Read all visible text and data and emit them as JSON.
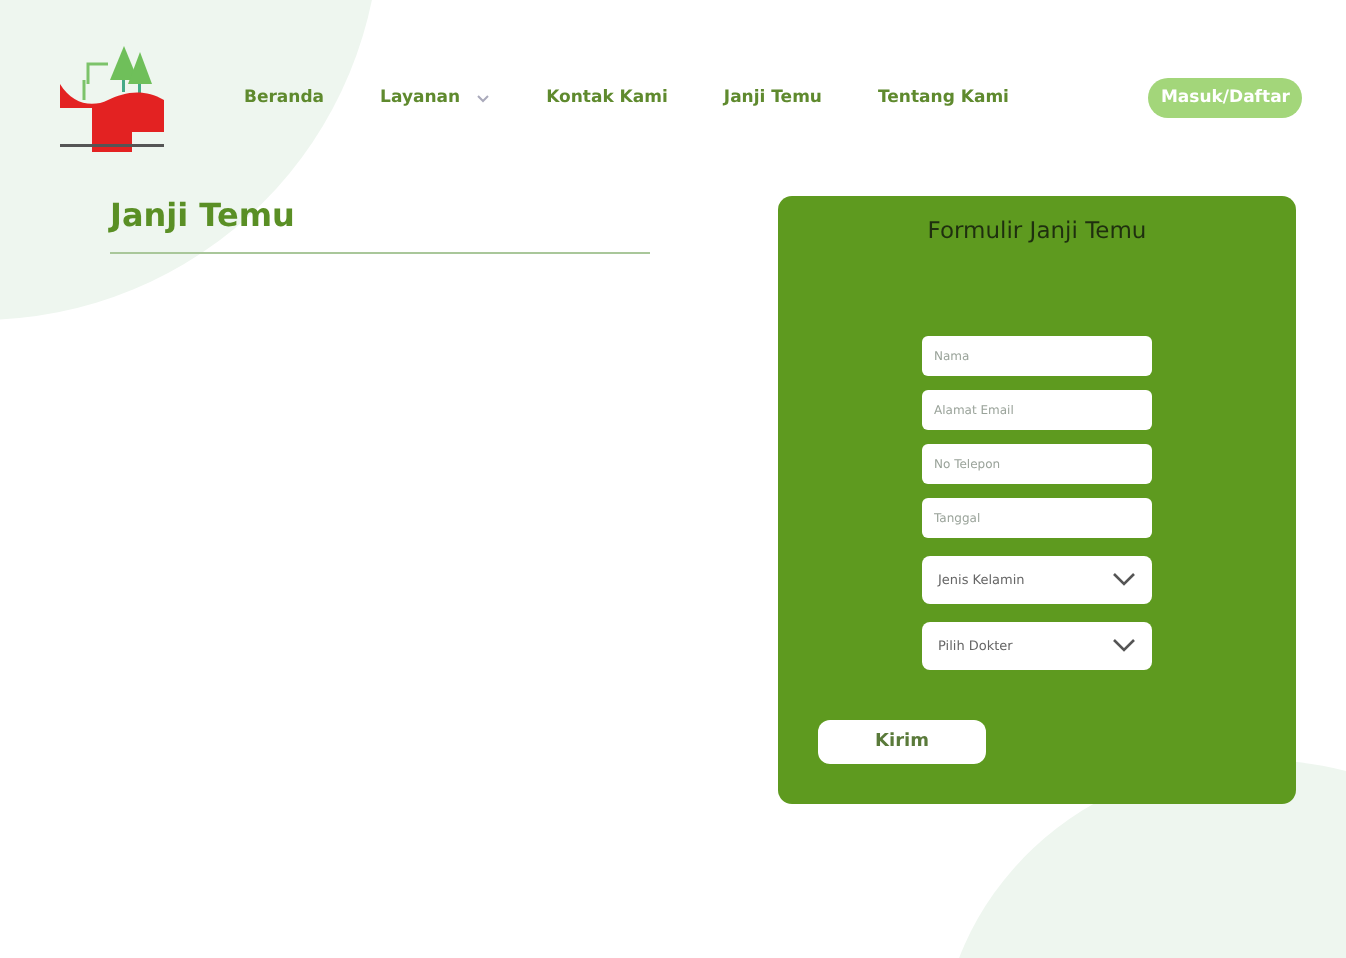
{
  "nav": {
    "items": [
      {
        "label": "Beranda",
        "dropdown": false
      },
      {
        "label": "Layanan",
        "dropdown": true
      },
      {
        "label": "Kontak Kami",
        "dropdown": false
      },
      {
        "label": "Janji Temu",
        "dropdown": false
      },
      {
        "label": "Tentang Kami",
        "dropdown": false
      }
    ],
    "login_button": "Masuk/Daftar"
  },
  "page_title": "Janji Temu",
  "form": {
    "title": "Formulir Janji Temu",
    "fields": [
      {
        "kind": "text",
        "placeholder": "Nama"
      },
      {
        "kind": "text",
        "placeholder": "Alamat Email"
      },
      {
        "kind": "text",
        "placeholder": "No Telepon"
      },
      {
        "kind": "text",
        "placeholder": "Tanggal"
      },
      {
        "kind": "select",
        "placeholder": "Jenis Kelamin"
      },
      {
        "kind": "select",
        "placeholder": "Pilih Dokter"
      }
    ],
    "submit": "Kirim"
  }
}
